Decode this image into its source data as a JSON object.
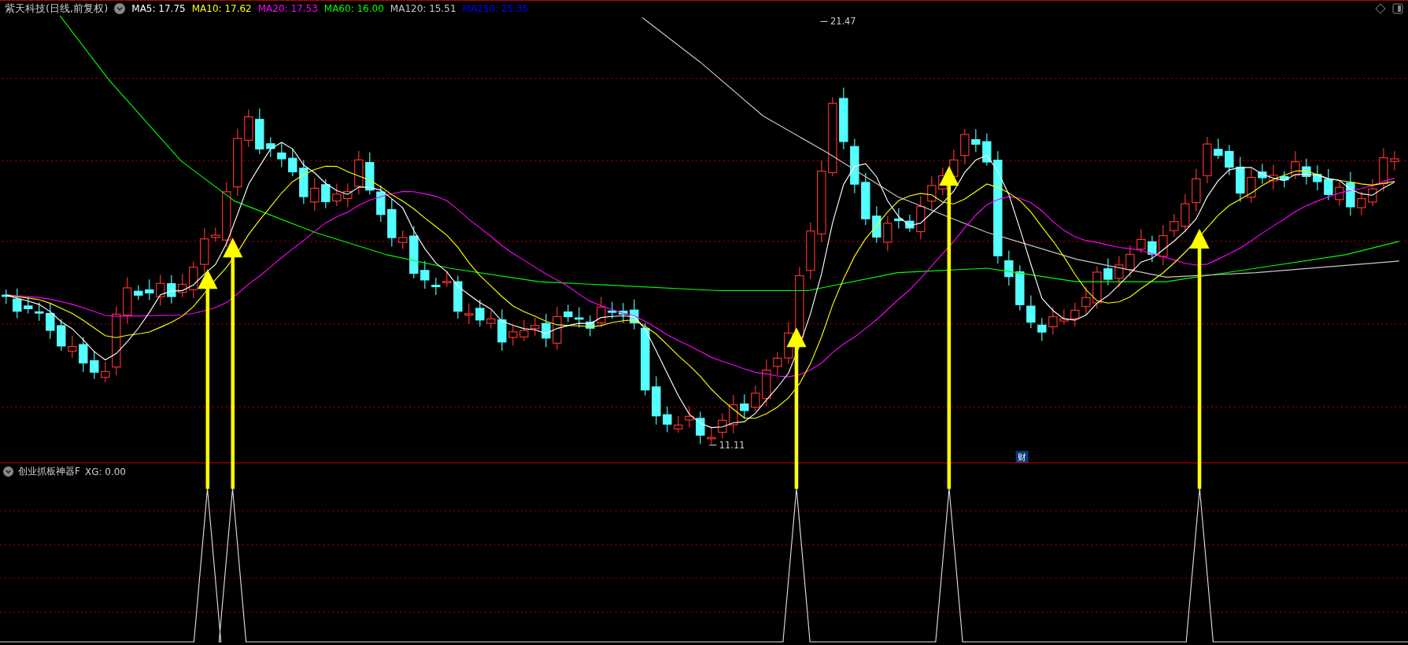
{
  "title": "紫天科技(日线,前复权)",
  "moving_averages": [
    {
      "label": "MA5: 17.75",
      "color": "#ffffff"
    },
    {
      "label": "MA10: 17.62",
      "color": "#ffff00"
    },
    {
      "label": "MA20: 17.53",
      "color": "#ff00ff"
    },
    {
      "label": "MA60: 16.00",
      "color": "#00ff00"
    },
    {
      "label": "MA120: 15.51",
      "color": "#c8c8c8"
    },
    {
      "label": "MA250: 25.35",
      "color": "#0000ff"
    }
  ],
  "price_labels": {
    "high": "21.47",
    "low": "11.11"
  },
  "event_badge": "财",
  "indicator": {
    "name": "创业抓板神器F",
    "reading": "XG: 0.00"
  }
}
